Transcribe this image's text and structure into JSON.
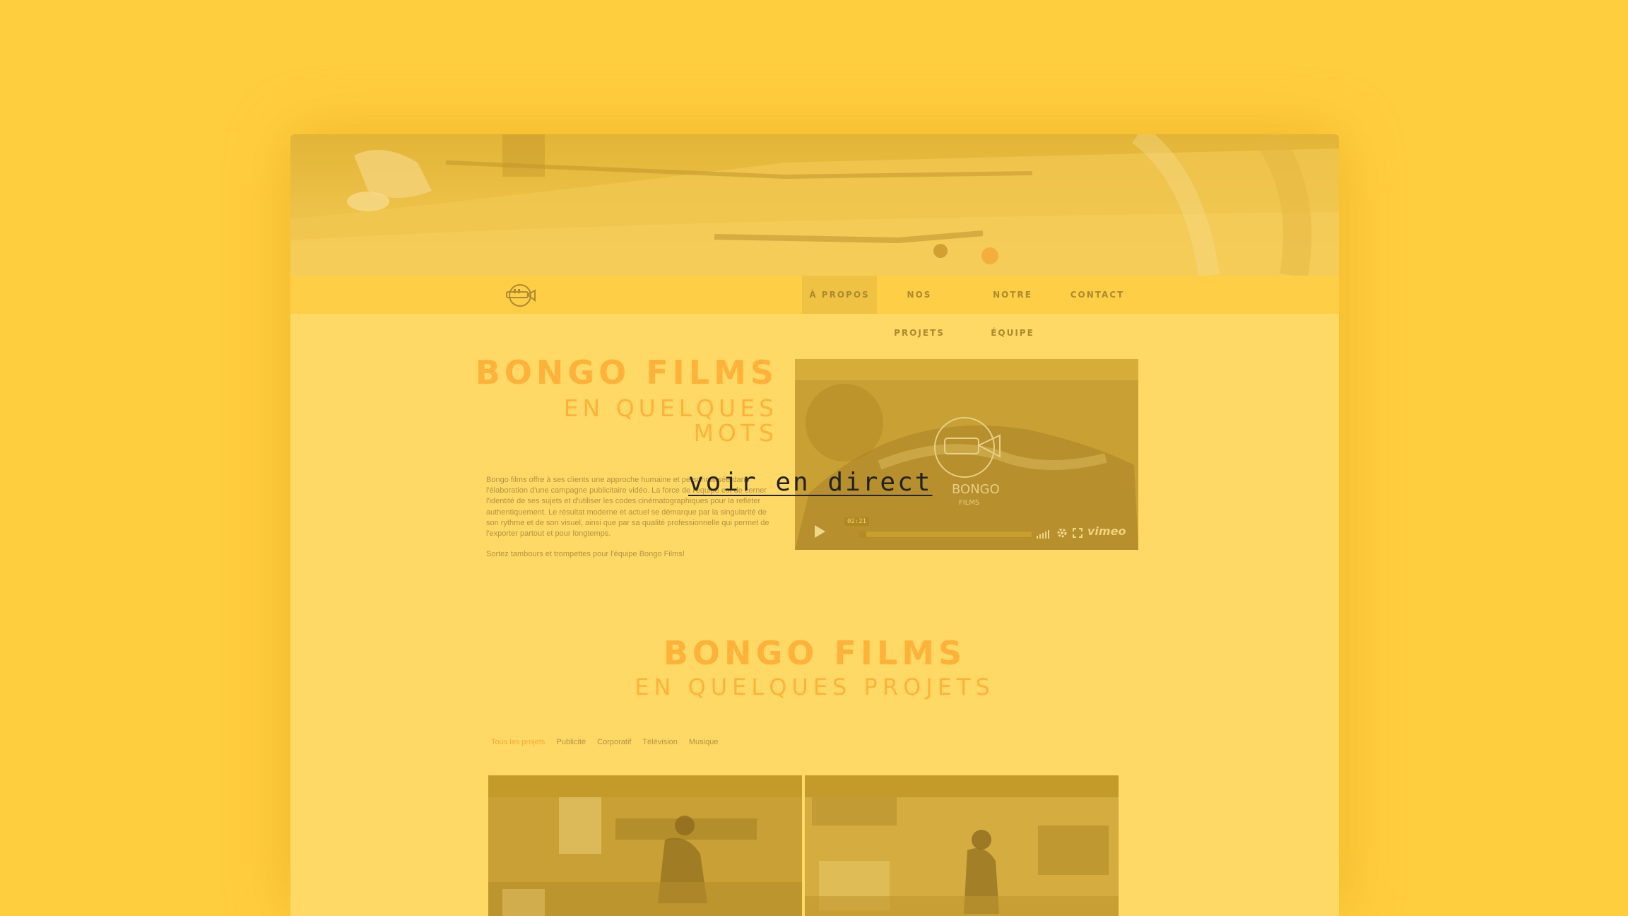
{
  "colors": {
    "background": "#FFCE3E",
    "page": "#FFD966",
    "accent": "#FFB23A",
    "nav_active": "#F0C244",
    "text": "#B49244"
  },
  "nav": {
    "logo": "bongo-films-trumpet-logo",
    "items": [
      {
        "label": "À PROPOS",
        "active": true
      },
      {
        "label": "NOS PROJETS"
      },
      {
        "label": "NOTRE ÉQUIPE"
      },
      {
        "label": "CONTACT"
      }
    ]
  },
  "about": {
    "title": "BONGO FILMS",
    "subtitle_line1": "EN QUELQUES",
    "subtitle_line2": "MOTS",
    "paragraph": "Bongo films offre à ses clients une approche humaine et personnalisée dans l'élaboration d'une campagne publicitaire vidéo. La force de l'équipe est de cerner l'identité de ses sujets et d'utiliser les codes cinématographiques pour la refléter authentiquement. Le résultat moderne et actuel se démarque par la singularité de son rythme et de son visuel, ainsi que par sa qualité professionnelle qui permet de l'exporter partout et pour longtemps.",
    "closing": "Sortez tambours et trompettes pour l'équipe Bongo Films!"
  },
  "video": {
    "time": "02:21",
    "progress": 0.04,
    "brand": "vimeo",
    "watermark": "BONGO FILMS",
    "icons": [
      "play-icon",
      "volume-icon",
      "gear-icon",
      "fullscreen-icon"
    ]
  },
  "projects": {
    "title": "BONGO FILMS",
    "subtitle": "EN QUELQUES PROJETS",
    "filters": [
      {
        "label": "Tous les projets",
        "active": true
      },
      {
        "label": "Publicité"
      },
      {
        "label": "Corporatif"
      },
      {
        "label": "Télévision"
      },
      {
        "label": "Musique"
      }
    ]
  },
  "overlay": {
    "link": "voir en direct"
  }
}
